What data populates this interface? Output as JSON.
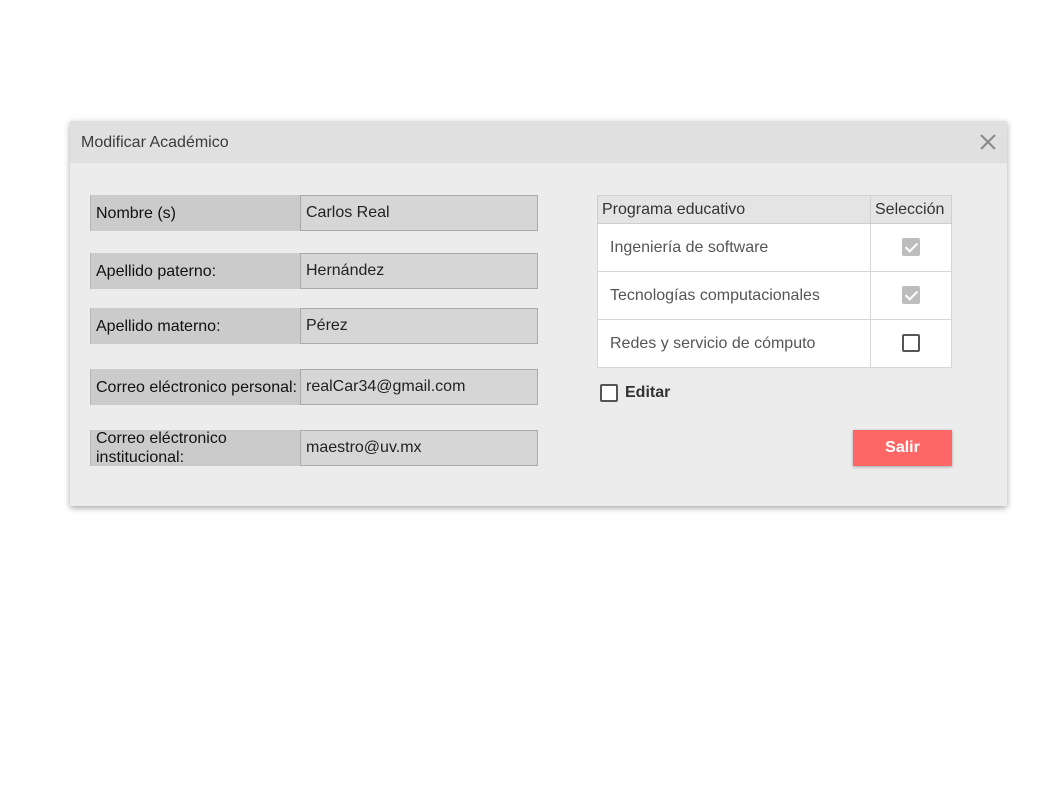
{
  "dialog": {
    "title": "Modificar Académico",
    "close_icon": "close-icon"
  },
  "form": {
    "fields": [
      {
        "label": "Nombre (s)",
        "value": "Carlos Real"
      },
      {
        "label": "Apellido paterno:",
        "value": "Hernández"
      },
      {
        "label": "Apellido materno:",
        "value": "Pérez"
      },
      {
        "label": "Correo eléctronico personal:",
        "value": "realCar34@gmail.com"
      },
      {
        "label": "Correo eléctronico institucional:",
        "value": "maestro@uv.mx"
      }
    ]
  },
  "programs": {
    "headers": [
      "Programa educativo",
      "Selección"
    ],
    "rows": [
      {
        "name": "Ingeniería de software",
        "selected": true,
        "disabled": true
      },
      {
        "name": "Tecnologías computacionales",
        "selected": true,
        "disabled": true
      },
      {
        "name": "Redes y servicio de cómputo",
        "selected": false,
        "disabled": false
      }
    ]
  },
  "editar": {
    "label": "Editar",
    "checked": false
  },
  "actions": {
    "exit_label": "Salir",
    "exit_color": "#ff6666"
  }
}
